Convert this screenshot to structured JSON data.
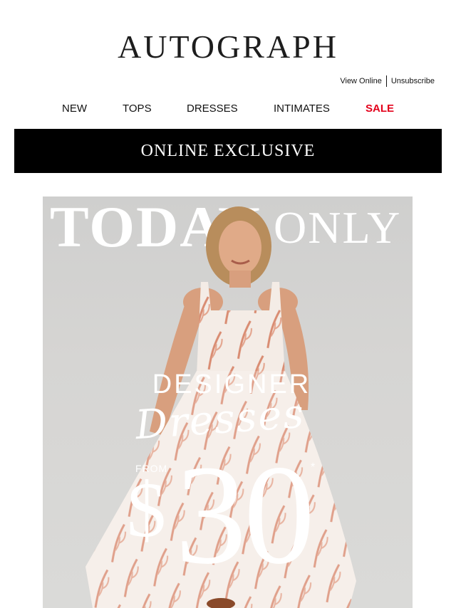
{
  "brand": {
    "logo_text": "AUTOGRAPH"
  },
  "utility_links": [
    {
      "label": "View Online"
    },
    {
      "label": "Unsubscribe"
    }
  ],
  "nav": [
    {
      "label": "NEW"
    },
    {
      "label": "TOPS"
    },
    {
      "label": "DRESSES"
    },
    {
      "label": "INTIMATES"
    },
    {
      "label": "SALE",
      "color": "#e3001b"
    }
  ],
  "banner": {
    "text": "ONLINE EXCLUSIVE"
  },
  "hero": {
    "headline_1": "TODAY",
    "headline_2": "ONLY",
    "line_1": "DESIGNER",
    "line_2": "Dresses",
    "from": "FROM",
    "currency": "$",
    "price": "30",
    "asterisk": "*",
    "image": "model-in-patterned-dress"
  },
  "colors": {
    "accent_sale": "#e3001b",
    "banner_bg": "#000000",
    "hero_bg": "#d6d5d3"
  }
}
